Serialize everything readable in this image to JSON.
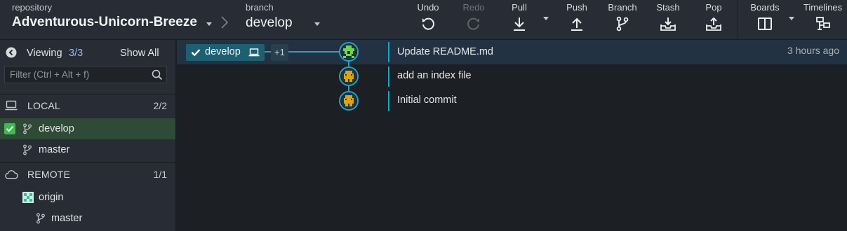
{
  "toolbar": {
    "repository_label": "repository",
    "repository_name": "Adventurous-Unicorn-Breeze",
    "branch_label": "branch",
    "branch_name": "develop",
    "buttons": {
      "undo": "Undo",
      "redo": "Redo",
      "pull": "Pull",
      "push": "Push",
      "branch": "Branch",
      "stash": "Stash",
      "pop": "Pop",
      "boards": "Boards",
      "timelines": "Timelines"
    }
  },
  "sidebar": {
    "viewing_label": "Viewing",
    "viewing_count": "3/3",
    "show_all": "Show All",
    "filter_placeholder": "Filter (Ctrl + Alt + f)",
    "local": {
      "label": "LOCAL",
      "count": "2/2",
      "branches": [
        "develop",
        "master"
      ]
    },
    "remote": {
      "label": "REMOTE",
      "count": "1/1",
      "remote_name": "origin",
      "branches": [
        "master"
      ]
    }
  },
  "graph": {
    "branch_tag": "develop",
    "extra_refs": "+1",
    "commits": [
      {
        "message": "Update README.md",
        "time": "3 hours ago"
      },
      {
        "message": "add an index file",
        "time": ""
      },
      {
        "message": "Initial commit",
        "time": ""
      }
    ]
  },
  "colors": {
    "accent": "#1fa6c1",
    "active_branch_bg": "#2f4a36",
    "checkbox": "#3fb950",
    "avatar_green": "#6fd64c",
    "avatar_yellow": "#d8a51a"
  }
}
